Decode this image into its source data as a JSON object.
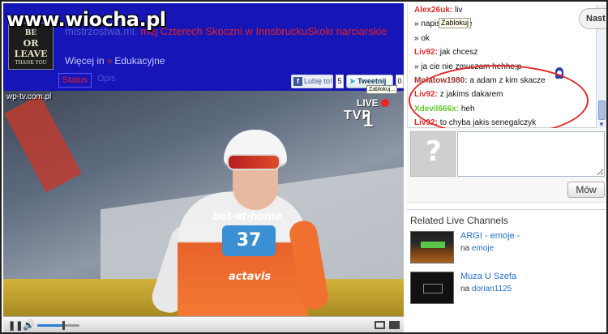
{
  "watermark": "www.wiocha.pl",
  "poster": {
    "line1": "BE",
    "line2": "OR LEAVE",
    "line3": "THANK YOU"
  },
  "channel": {
    "title_faded": "mistrzostwa.ml.",
    "title": "mej Czterech Skoczni w InnsbruckuSkoki narciarskie",
    "crumbs": {
      "more": "Więcej in",
      "sep": "»",
      "category": "Edukacyjne"
    },
    "tabs": {
      "status": "Status",
      "opis": "Opis"
    }
  },
  "social": {
    "like": "Lubię to!",
    "like_count": "5",
    "tweet": "Tweetnij",
    "tweet_count": "0",
    "block_tip": "Zablokuj..."
  },
  "video": {
    "source": "wp-tv.com.pl",
    "live": "LIVE",
    "tvp": "TVP",
    "tvp_num": "1",
    "bib_number": "37",
    "bib_logo": "bet-at-home",
    "bib_logo2": "actavis",
    "controls": {
      "play": "❚❚",
      "volume": "🔊",
      "volume_level": 0.62
    }
  },
  "chat": {
    "messages": [
      {
        "user": "Alex26uk:",
        "text": "liv",
        "style": "red"
      },
      {
        "user": "",
        "text": "» napisz ci prive",
        "style": ""
      },
      {
        "user": "",
        "text": "» ok",
        "style": ""
      },
      {
        "user": "Liv92:",
        "text": "jak chcesz",
        "style": "red"
      },
      {
        "user": "",
        "text": "» ja cie nie zmuszam hehhe;p",
        "style": ""
      },
      {
        "user": "Molatow1980:",
        "text": "a adam z kim skacze",
        "style": "maroon"
      },
      {
        "user": "Liv92:",
        "text": "z jakims dakarem",
        "style": "red"
      },
      {
        "user": "Xdevil666x:",
        "text": "heh",
        "style": "green"
      },
      {
        "user": "Liv92:",
        "text": "to chyba jakis senegalczyk",
        "style": "red"
      }
    ],
    "tooltip": "Zablokuj",
    "next_label": "Nast",
    "send_label": "Mów"
  },
  "related": {
    "title": "Related Live Channels",
    "items": [
      {
        "name": "ARGI - emoje -",
        "by_prefix": "na",
        "by_user": "emoje"
      },
      {
        "name": "Muza U Szefa",
        "by_prefix": "na",
        "by_user": "dorian1125"
      }
    ]
  }
}
